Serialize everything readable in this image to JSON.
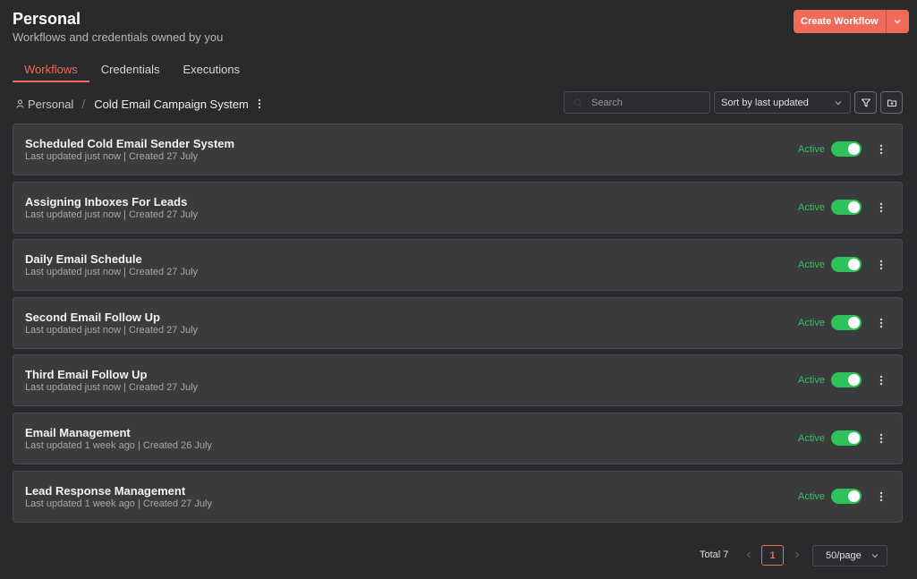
{
  "header": {
    "title": "Personal",
    "subtitle": "Workflows and credentials owned by you",
    "create_label": "Create Workflow"
  },
  "tabs": [
    {
      "label": "Workflows",
      "active": true
    },
    {
      "label": "Credentials",
      "active": false
    },
    {
      "label": "Executions",
      "active": false
    }
  ],
  "breadcrumb": {
    "home": "Personal",
    "separator": "/",
    "current": "Cold Email Campaign System"
  },
  "toolbar": {
    "search_placeholder": "Search",
    "sort_label": "Sort by last updated"
  },
  "workflows": [
    {
      "name": "Scheduled Cold Email Sender System",
      "meta": "Last updated just now | Created 27 July",
      "status": "Active",
      "enabled": true
    },
    {
      "name": "Assigning Inboxes For Leads",
      "meta": "Last updated just now | Created 27 July",
      "status": "Active",
      "enabled": true
    },
    {
      "name": "Daily Email Schedule",
      "meta": "Last updated just now | Created 27 July",
      "status": "Active",
      "enabled": true
    },
    {
      "name": "Second Email Follow Up",
      "meta": "Last updated just now | Created 27 July",
      "status": "Active",
      "enabled": true
    },
    {
      "name": "Third Email Follow Up",
      "meta": "Last updated just now | Created 27 July",
      "status": "Active",
      "enabled": true
    },
    {
      "name": "Email Management",
      "meta": "Last updated 1 week ago | Created 26 July",
      "status": "Active",
      "enabled": true
    },
    {
      "name": "Lead Response Management",
      "meta": "Last updated 1 week ago | Created 27 July",
      "status": "Active",
      "enabled": true
    }
  ],
  "pagination": {
    "total_label": "Total 7",
    "current_page": "1",
    "page_size": "50/page"
  },
  "colors": {
    "accent": "#ef6a5a",
    "active_green": "#2ec35a",
    "background": "#292a2c",
    "card": "#3a3b3d"
  },
  "icons": {
    "create_split": "chevron-down-icon",
    "home": "user-icon",
    "more": "vertical-dots-icon",
    "search": "search-icon",
    "sort": "chevron-down-icon",
    "filter": "filter-icon",
    "folder": "folder-plus-icon",
    "prev": "chevron-left-icon",
    "next": "chevron-right-icon"
  }
}
